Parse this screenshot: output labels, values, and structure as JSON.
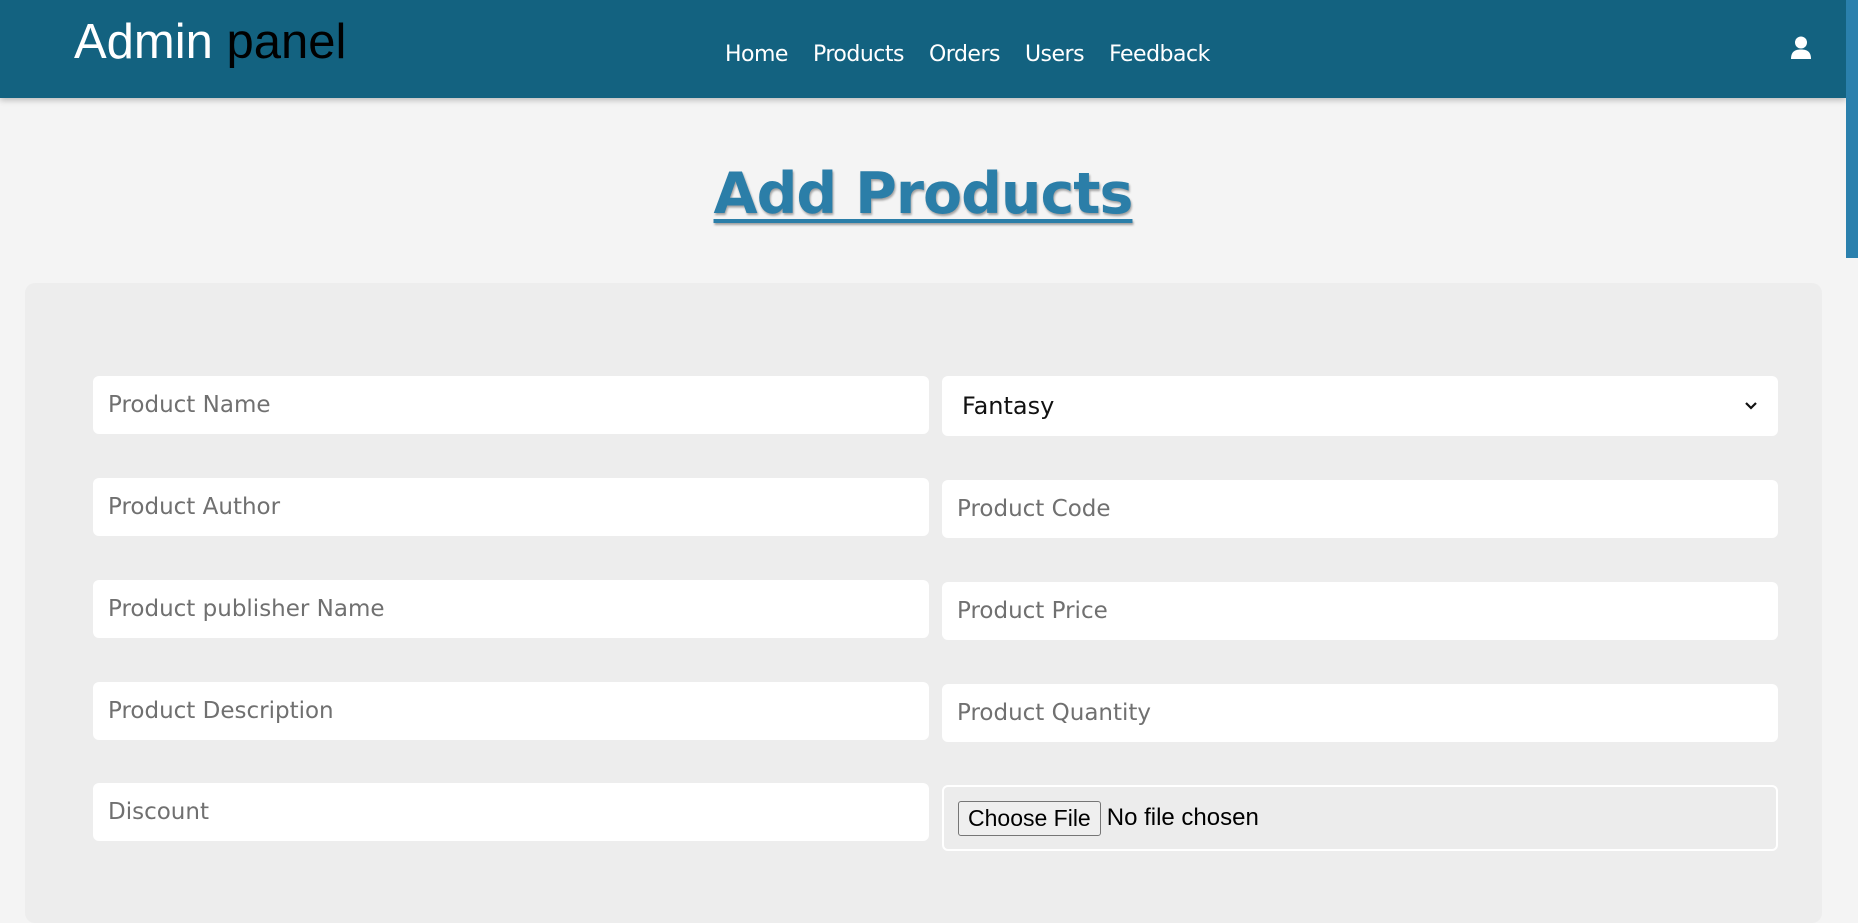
{
  "header": {
    "brand_main": "Admin ",
    "brand_accent": "panel",
    "nav": [
      "Home",
      "Products",
      "Orders",
      "Users",
      "Feedback"
    ],
    "user_icon": "user-icon"
  },
  "page": {
    "title": "Add Products"
  },
  "form": {
    "product_name_placeholder": "Product Name",
    "category_selected": "Fantasy",
    "product_author_placeholder": "Product Author",
    "product_code_placeholder": "Product Code",
    "publisher_placeholder": "Product publisher Name",
    "price_placeholder": "Product Price",
    "description_placeholder": "Product Description",
    "quantity_placeholder": "Product Quantity",
    "discount_placeholder": "Discount",
    "file_button": "Choose File",
    "file_status": "No file chosen"
  },
  "colors": {
    "header": "#136280",
    "title": "#2b7ea8"
  }
}
